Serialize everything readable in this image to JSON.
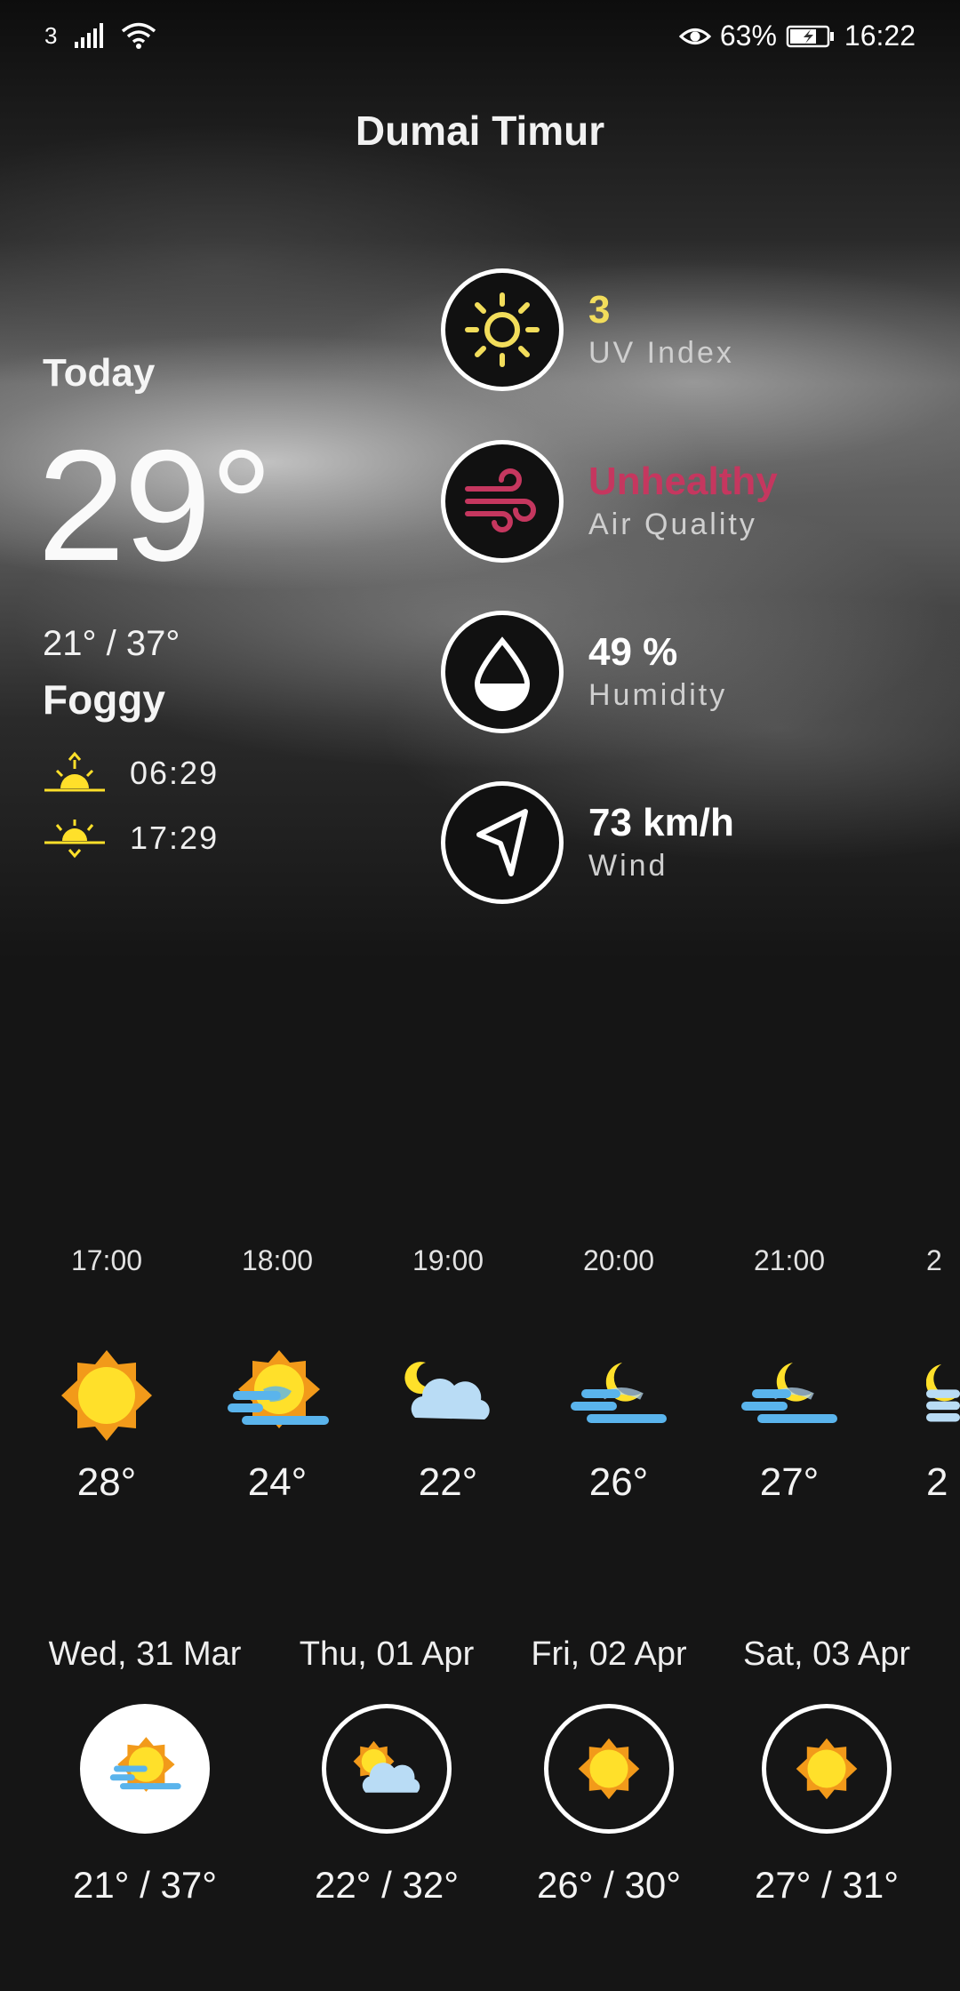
{
  "status_bar": {
    "sim": "3",
    "battery": "63%",
    "time": "16:22"
  },
  "location": "Dumai Timur",
  "today": {
    "label": "Today",
    "temperature": "29°",
    "range": "21° / 37°",
    "condition": "Foggy",
    "sunrise": "06:29",
    "sunset": "17:29"
  },
  "metrics": [
    {
      "value": "3",
      "label": "UV Index",
      "color": "#f2dd5b",
      "icon": "sun-icon"
    },
    {
      "value": "Unhealthy",
      "label": "Air Quality",
      "color": "#c5375f",
      "icon": "wind-icon"
    },
    {
      "value": "49 %",
      "label": "Humidity",
      "color": "#ffffff",
      "icon": "droplet-icon"
    },
    {
      "value": "73 km/h",
      "label": "Wind",
      "color": "#ffffff",
      "icon": "navigation-arrow-icon"
    }
  ],
  "hourly": [
    {
      "time": "17:00",
      "temp": "28°",
      "icon": "sunny-icon"
    },
    {
      "time": "18:00",
      "temp": "24°",
      "icon": "foggy-sun-icon"
    },
    {
      "time": "19:00",
      "temp": "22°",
      "icon": "cloudy-night-icon"
    },
    {
      "time": "20:00",
      "temp": "26°",
      "icon": "foggy-night-icon"
    },
    {
      "time": "21:00",
      "temp": "27°",
      "icon": "foggy-night-icon"
    },
    {
      "time": "2",
      "temp": "2",
      "icon": "foggy-night-icon"
    }
  ],
  "daily": [
    {
      "day": "Wed, 31 Mar",
      "range": "21° / 37°",
      "icon": "foggy-sun-icon",
      "selected": true
    },
    {
      "day": "Thu, 01 Apr",
      "range": "22° / 32°",
      "icon": "partly-cloudy-icon",
      "selected": false
    },
    {
      "day": "Fri, 02 Apr",
      "range": "26° / 30°",
      "icon": "sunny-icon",
      "selected": false
    },
    {
      "day": "Sat, 03 Apr",
      "range": "27° / 31°",
      "icon": "sunny-icon",
      "selected": false
    }
  ],
  "colors": {
    "background": "#151515",
    "uv_accent": "#f2dd5b",
    "air_quality_accent": "#c5375f",
    "sun_orange": "#f29a1a",
    "sun_yellow": "#ffe02a",
    "fog_blue": "#5ab4ec",
    "cloud_blue": "#b9dcf5"
  }
}
